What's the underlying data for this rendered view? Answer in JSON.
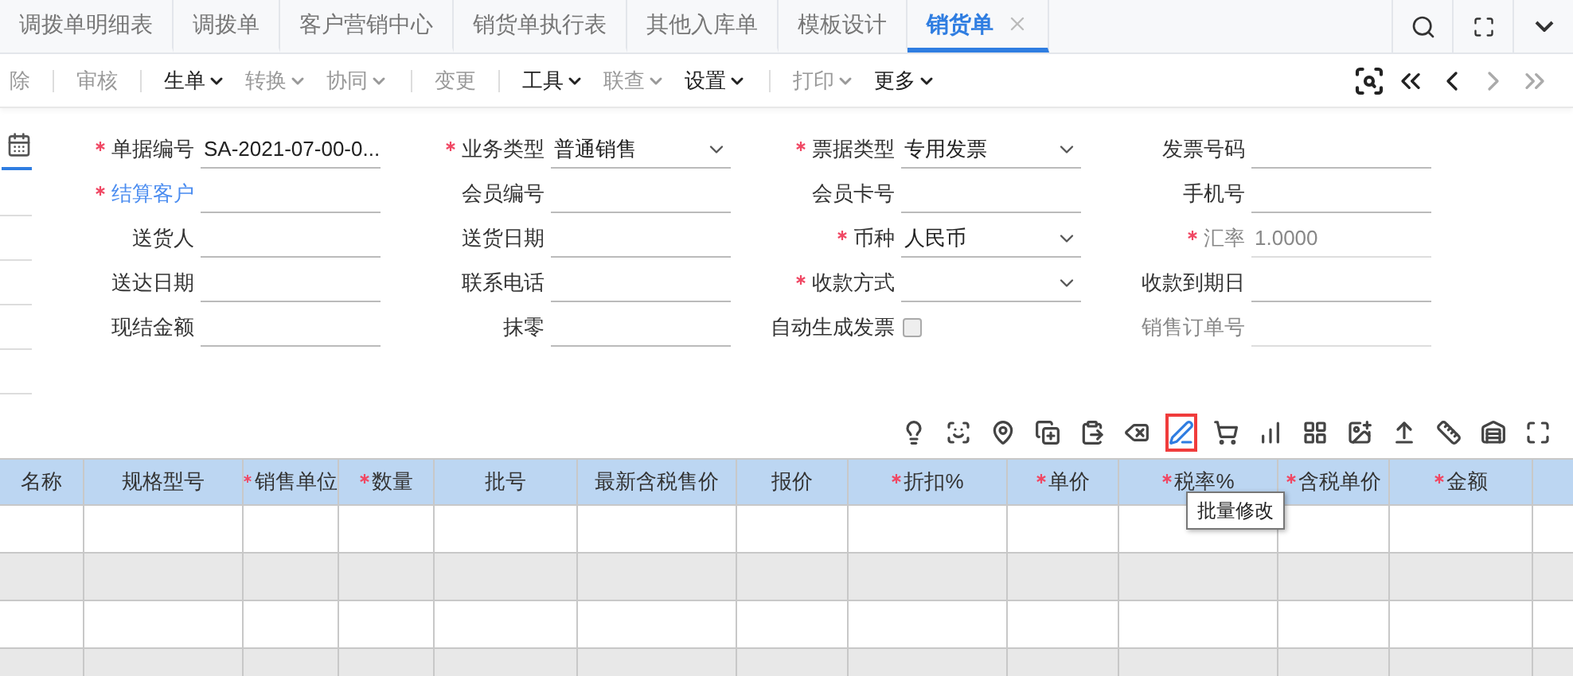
{
  "tabs": [
    {
      "label": "调拨单明细表",
      "selected": false,
      "closable": false
    },
    {
      "label": "调拨单",
      "selected": false,
      "closable": false
    },
    {
      "label": "客户营销中心",
      "selected": false,
      "closable": false
    },
    {
      "label": "销货单执行表",
      "selected": false,
      "closable": false
    },
    {
      "label": "其他入库单",
      "selected": false,
      "closable": false
    },
    {
      "label": "模板设计",
      "selected": false,
      "closable": false
    },
    {
      "label": "销货单",
      "selected": true,
      "closable": true
    }
  ],
  "toolbar_groups": [
    [
      {
        "label": "除",
        "dropdown": false,
        "disabled": true
      }
    ],
    [
      {
        "label": "审核",
        "dropdown": false,
        "disabled": true
      }
    ],
    [
      {
        "label": "生单",
        "dropdown": true,
        "disabled": false
      },
      {
        "label": "转换",
        "dropdown": true,
        "disabled": true
      },
      {
        "label": "协同",
        "dropdown": true,
        "disabled": true
      }
    ],
    [
      {
        "label": "变更",
        "dropdown": false,
        "disabled": true
      }
    ],
    [
      {
        "label": "工具",
        "dropdown": true,
        "disabled": false
      },
      {
        "label": "联查",
        "dropdown": true,
        "disabled": true
      },
      {
        "label": "设置",
        "dropdown": true,
        "disabled": false
      }
    ],
    [
      {
        "label": "打印",
        "dropdown": true,
        "disabled": true
      },
      {
        "label": "更多",
        "dropdown": true,
        "disabled": false
      }
    ]
  ],
  "record_nav": [
    {
      "kind": "first",
      "disabled": false
    },
    {
      "kind": "prev",
      "disabled": false
    },
    {
      "kind": "next",
      "disabled": true
    },
    {
      "kind": "last",
      "disabled": true
    }
  ],
  "form_rows": [
    [
      {
        "label": "单据编号",
        "required": true,
        "link": false,
        "disabled": false,
        "kind": "text",
        "value": "SA-2021-07-00-0..."
      },
      {
        "label": "业务类型",
        "required": true,
        "link": false,
        "disabled": false,
        "kind": "select",
        "value": "普通销售"
      },
      {
        "label": "票据类型",
        "required": true,
        "link": false,
        "disabled": false,
        "kind": "select",
        "value": "专用发票"
      },
      {
        "label": "发票号码",
        "required": false,
        "link": false,
        "disabled": false,
        "kind": "text"
      }
    ],
    [
      {
        "label": "结算客户",
        "required": true,
        "link": true,
        "disabled": false,
        "kind": "text"
      },
      {
        "label": "会员编号",
        "required": false,
        "link": false,
        "disabled": false,
        "kind": "text"
      },
      {
        "label": "会员卡号",
        "required": false,
        "link": false,
        "disabled": false,
        "kind": "text"
      },
      {
        "label": "手机号",
        "required": false,
        "link": false,
        "disabled": false,
        "kind": "text"
      }
    ],
    [
      {
        "label": "送货人",
        "required": false,
        "link": false,
        "disabled": false,
        "kind": "text"
      },
      {
        "label": "送货日期",
        "required": false,
        "link": false,
        "disabled": false,
        "kind": "text"
      },
      {
        "label": "币种",
        "required": true,
        "link": false,
        "disabled": false,
        "kind": "select",
        "value": "人民币"
      },
      {
        "label": "汇率",
        "required": true,
        "link": false,
        "disabled": true,
        "kind": "text",
        "value": "1.0000"
      }
    ],
    [
      {
        "label": "送达日期",
        "required": false,
        "link": false,
        "disabled": false,
        "kind": "text"
      },
      {
        "label": "联系电话",
        "required": false,
        "link": false,
        "disabled": false,
        "kind": "text"
      },
      {
        "label": "收款方式",
        "required": true,
        "link": false,
        "disabled": false,
        "kind": "select"
      },
      {
        "label": "收款到期日",
        "required": false,
        "link": false,
        "disabled": false,
        "kind": "text"
      }
    ],
    [
      {
        "label": "现结金额",
        "required": false,
        "link": false,
        "disabled": false,
        "kind": "text"
      },
      {
        "label": "抹零",
        "required": false,
        "link": false,
        "disabled": false,
        "kind": "text"
      },
      {
        "label": "自动生成发票",
        "required": false,
        "link": false,
        "disabled": false,
        "kind": "checkbox",
        "checked": false
      },
      {
        "label": "销售订单号",
        "required": false,
        "link": false,
        "disabled": true,
        "kind": "text"
      }
    ]
  ],
  "grid_tools": [
    {
      "kind": "bulb",
      "highlighted": false
    },
    {
      "kind": "scan",
      "highlighted": false
    },
    {
      "kind": "pin",
      "highlighted": false
    },
    {
      "kind": "copy-plus",
      "highlighted": false
    },
    {
      "kind": "paste",
      "highlighted": false
    },
    {
      "kind": "delete",
      "highlighted": false
    },
    {
      "kind": "pen",
      "highlighted": true
    },
    {
      "kind": "cart",
      "highlighted": false
    },
    {
      "kind": "chart",
      "highlighted": false
    },
    {
      "kind": "grid-plus",
      "highlighted": false
    },
    {
      "kind": "image",
      "highlighted": false
    },
    {
      "kind": "grid-up",
      "highlighted": false
    },
    {
      "kind": "ruler",
      "highlighted": false
    },
    {
      "kind": "house",
      "highlighted": false
    },
    {
      "kind": "maximize",
      "highlighted": false
    }
  ],
  "tooltip": "批量修改",
  "table": {
    "columns": [
      {
        "label": "名称",
        "required": false
      },
      {
        "label": "规格型号",
        "required": false
      },
      {
        "label": "销售单位",
        "required": true
      },
      {
        "label": "数量",
        "required": true
      },
      {
        "label": "批号",
        "required": false
      },
      {
        "label": "最新含税售价",
        "required": false
      },
      {
        "label": "报价",
        "required": false
      },
      {
        "label": "折扣%",
        "required": true
      },
      {
        "label": "单价",
        "required": true
      },
      {
        "label": "税率%",
        "required": true
      },
      {
        "label": "含税单价",
        "required": true
      },
      {
        "label": "金额",
        "required": true
      }
    ]
  }
}
